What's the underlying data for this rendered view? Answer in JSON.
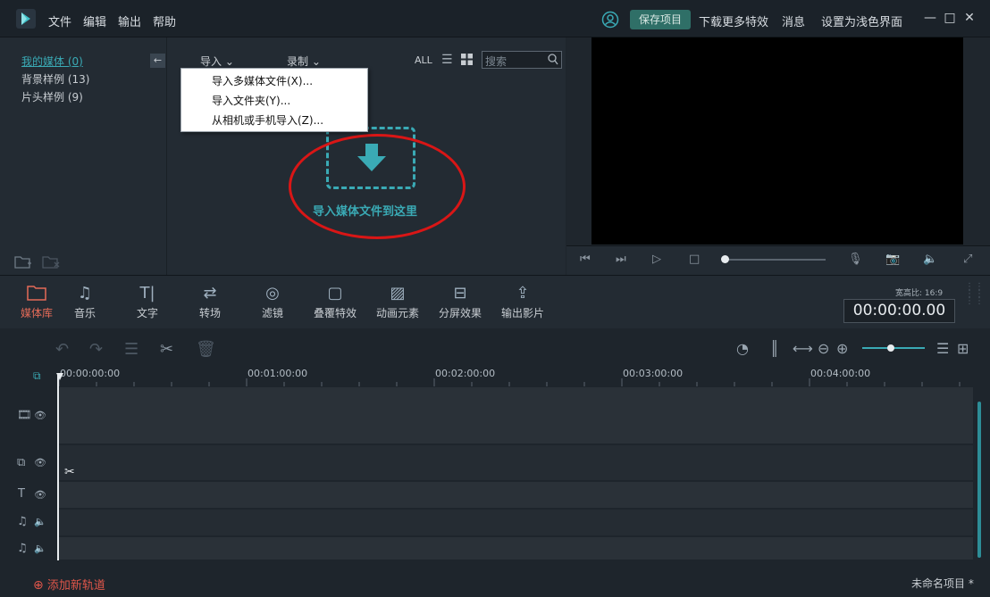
{
  "menu": {
    "file": "文件",
    "edit": "编辑",
    "export": "输出",
    "help": "帮助"
  },
  "titlebar": {
    "save_project": "保存项目",
    "download_effects": "下载更多特效",
    "messages": "消息",
    "light_theme": "设置为浅色界面"
  },
  "library": {
    "my_media": "我的媒体 (0)",
    "bg_samples": "背景样例 (13)",
    "intro_samples": "片头样例 (9)"
  },
  "media": {
    "import": "导入",
    "record": "录制",
    "all": "ALL",
    "search_placeholder": "搜索",
    "drop_text": "导入媒体文件到这里"
  },
  "import_menu": {
    "item1": "导入多媒体文件(X)...",
    "item2": "导入文件夹(Y)...",
    "item3": "从相机或手机导入(Z)..."
  },
  "toolbar": {
    "media": "媒体库",
    "music": "音乐",
    "text": "文字",
    "transition": "转场",
    "filter": "滤镜",
    "overlay": "叠覆特效",
    "elements": "动画元素",
    "split": "分屏效果",
    "export": "输出影片"
  },
  "preview": {
    "aspect": "宽高比: 16:9",
    "timecode": "00:00:00.00"
  },
  "timeline": {
    "t0": "00:00:00:00",
    "t1": "00:01:00:00",
    "t2": "00:02:00:00",
    "t3": "00:03:00:00",
    "t4": "00:04:00:00"
  },
  "status": {
    "add_track": "添加新轨道",
    "project_name": "未命名项目 *"
  },
  "colors": {
    "accent": "#3aaab5",
    "active": "#e56b58",
    "annotation": "#d91616"
  }
}
